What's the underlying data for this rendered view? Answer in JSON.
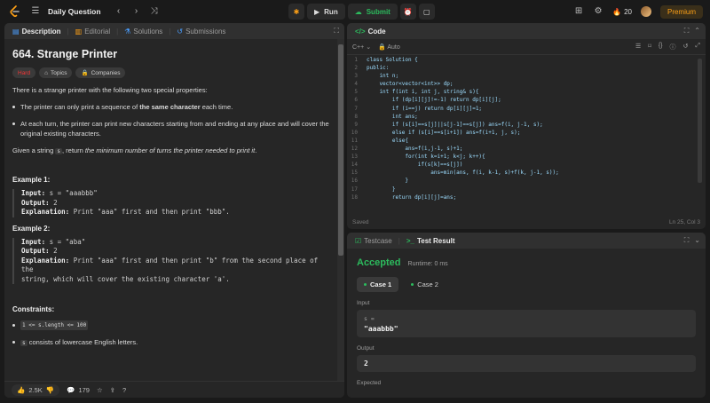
{
  "topbar": {
    "title": "Daily Question",
    "run_label": "Run",
    "submit_label": "Submit",
    "streak_count": "20",
    "premium_label": "Premium"
  },
  "desc_tabs": [
    "Description",
    "Editorial",
    "Solutions",
    "Submissions"
  ],
  "problem": {
    "title": "664. Strange Printer",
    "difficulty": "Hard",
    "chip_topics": "Topics",
    "chip_companies": "Companies",
    "intro": "There is a strange printer with the following two special properties:",
    "bullet1_pre": "The printer can only print a sequence of ",
    "bullet1_bold": "the same character",
    "bullet1_post": " each time.",
    "bullet2": "At each turn, the printer can print new characters starting from and ending at any place and will cover the original existing characters.",
    "given_pre": "Given a string ",
    "given_var": "s",
    "given_mid": ", return ",
    "given_ital": "the minimum number of turns the printer needed to print it",
    "given_post": ".",
    "ex1_title": "Example 1:",
    "ex1_input_label": "Input:",
    "ex1_input": " s = \"aaabbb\"",
    "ex1_output_label": "Output:",
    "ex1_output": " 2",
    "ex1_expl_label": "Explanation:",
    "ex1_expl": " Print \"aaa\" first and then print \"bbb\".",
    "ex2_title": "Example 2:",
    "ex2_input_label": "Input:",
    "ex2_input": " s = \"aba\"",
    "ex2_output_label": "Output:",
    "ex2_output": " 2",
    "ex2_expl_label": "Explanation:",
    "ex2_expl_1": " Print \"aaa\" first and then print \"b\" from the second place of the",
    "ex2_expl_2": "string, which will cover the existing character 'a'.",
    "constraints_title": "Constraints:",
    "c1": "1 <= s.length <= 100",
    "c2_var": "s",
    "c2_text": " consists of lowercase English letters."
  },
  "desc_footer": {
    "likes": "2.5K",
    "comments": "179"
  },
  "code_panel": {
    "title": "Code",
    "language": "C++",
    "mode": "Auto",
    "status_left": "Saved",
    "status_right": "Ln 25, Col 3",
    "lines": [
      "class Solution {",
      "public:",
      "    int n;",
      "    vector<vector<int>> dp;",
      "    int f(int i, int j, string& s){",
      "        if (dp[i][j]!=-1) return dp[i][j];",
      "        if (i==j) return dp[i][j]=1;",
      "        int ans;",
      "        if (s[i]==s[j]||s[j-1]==s[j]) ans=f(i, j-1, s);",
      "        else if (s[i]==s[i+1]) ans=f(i+1, j, s);",
      "        else{",
      "            ans=f(i,j-1, s)+1;",
      "            for(int k=i+1; k<j; k++){",
      "                if(s[k]==s[j])",
      "                    ans=min(ans, f(i, k-1, s)+f(k, j-1, s));",
      "            }",
      "        }",
      "        return dp[i][j]=ans;"
    ]
  },
  "test_panel": {
    "tab_testcase": "Testcase",
    "tab_result": "Test Result",
    "verdict": "Accepted",
    "runtime": "Runtime: 0 ms",
    "case1": "Case 1",
    "case2": "Case 2",
    "input_label": "Input",
    "input_var": "s =",
    "input_value": "\"aaabbb\"",
    "output_label": "Output",
    "output_value": "2",
    "expected_label": "Expected"
  }
}
